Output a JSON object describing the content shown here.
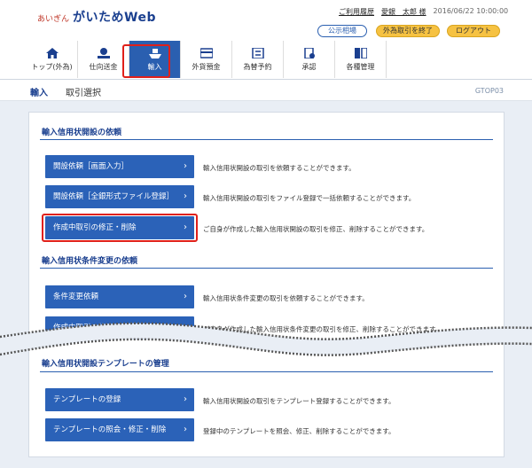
{
  "header": {
    "logo_sub": "あいぎん",
    "logo_main": "がいためWeb",
    "usage_history": "ご利用履歴",
    "user": "愛銀　太郎 様",
    "timestamp": "2016/06/22 10:00:00",
    "rates_label": "公示相場",
    "end_fx_label": "外為取引を終了",
    "logout_label": "ログアウト"
  },
  "nav": {
    "items": [
      {
        "label": "トップ(外為)",
        "icon": "home-icon"
      },
      {
        "label": "仕向送金",
        "icon": "remittance-icon"
      },
      {
        "label": "輸入",
        "icon": "import-ship-icon"
      },
      {
        "label": "外貨預金",
        "icon": "deposit-card-icon"
      },
      {
        "label": "為替予約",
        "icon": "exchange-contract-icon"
      },
      {
        "label": "承認",
        "icon": "approval-icon"
      },
      {
        "label": "各種管理",
        "icon": "management-icon"
      }
    ],
    "active_index": 2
  },
  "breadcrumb": {
    "category": "輸入",
    "page": "取引選択",
    "screen_code": "GTOP03"
  },
  "sections": [
    {
      "title": "輸入信用状開設の依頼",
      "rows": [
        {
          "button": "開設依頼［画面入力］",
          "desc": "輸入信用状開設の取引を依頼することができます。"
        },
        {
          "button": "開設依頼［全銀形式ファイル登録］",
          "desc": "輸入信用状開設の取引をファイル登録で一括依頼することができます。"
        },
        {
          "button": "作成中取引の修正・削除",
          "desc": "ご自身が作成した輸入信用状開設の取引を修正、削除することができます。"
        }
      ]
    },
    {
      "title": "輸入信用状条件変更の依頼",
      "rows": [
        {
          "button": "条件変更依頼",
          "desc": "輸入信用状条件変更の取引を依頼することができます。"
        },
        {
          "button": "作成中取引の修正・削除",
          "desc": "ご自身が作成した輸入信用状条件変更の取引を修正、削除することができます。"
        }
      ]
    },
    {
      "title": "輸入信用状開設テンプレートの管理",
      "rows": [
        {
          "button": "テンプレートの登録",
          "desc": "輸入信用状開設の取引をテンプレート登録することができます。"
        },
        {
          "button": "テンプレートの照会・修正・削除",
          "desc": "登録中のテンプレートを照会、修正、削除することができます。"
        }
      ]
    }
  ],
  "colors": {
    "brand_blue": "#2b62b8",
    "highlight_red": "#e0201a",
    "accent_yellow": "#f6c242"
  }
}
